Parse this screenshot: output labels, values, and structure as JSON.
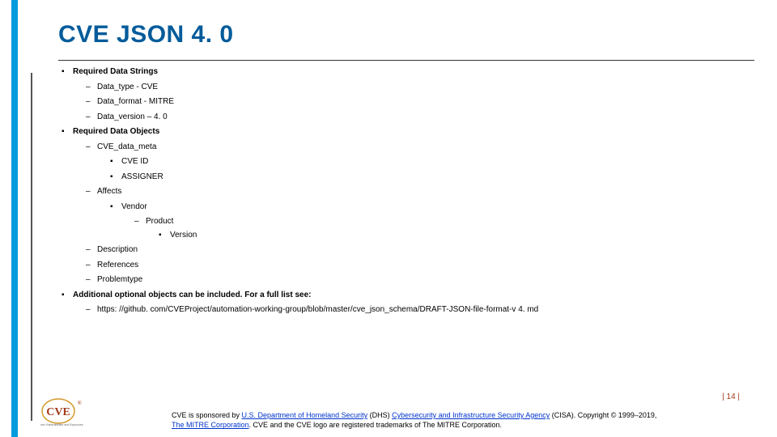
{
  "title": "CVE JSON 4. 0",
  "sections": [
    {
      "label": "Required Data Strings",
      "items": [
        {
          "label": "Data_type - CVE"
        },
        {
          "label": "Data_format - MITRE"
        },
        {
          "label": "Data_version – 4. 0"
        }
      ]
    },
    {
      "label": "Required Data Objects",
      "items": [
        {
          "label": "CVE_data_meta",
          "items": [
            {
              "label": "CVE ID"
            },
            {
              "label": "ASSIGNER"
            }
          ]
        },
        {
          "label": "Affects",
          "items": [
            {
              "label": "Vendor",
              "items": [
                {
                  "label": "Product",
                  "items": [
                    {
                      "label": "Version"
                    }
                  ]
                }
              ]
            }
          ]
        },
        {
          "label": "Description"
        },
        {
          "label": "References"
        },
        {
          "label": "Problemtype"
        }
      ]
    },
    {
      "label": "Additional optional objects can be included.  For a full list see:",
      "items": [
        {
          "label": "https: //github. com/CVEProject/automation-working-group/blob/master/cve_json_schema/DRAFT-JSON-file-format-v 4. md"
        }
      ]
    }
  ],
  "page_num": "| 14 |",
  "footer": {
    "part1": "CVE is sponsored by ",
    "link1": "U.S. Department of Homeland Security",
    "part2": " (DHS) ",
    "link2": "Cybersecurity and Infrastructure Security Agency",
    "part3": " (CISA). Copyright © 1999–2019, ",
    "link3": "The MITRE Corporation",
    "part4": ". CVE and the CVE logo are registered trademarks of The MITRE Corporation."
  },
  "logo_name": "CVE"
}
